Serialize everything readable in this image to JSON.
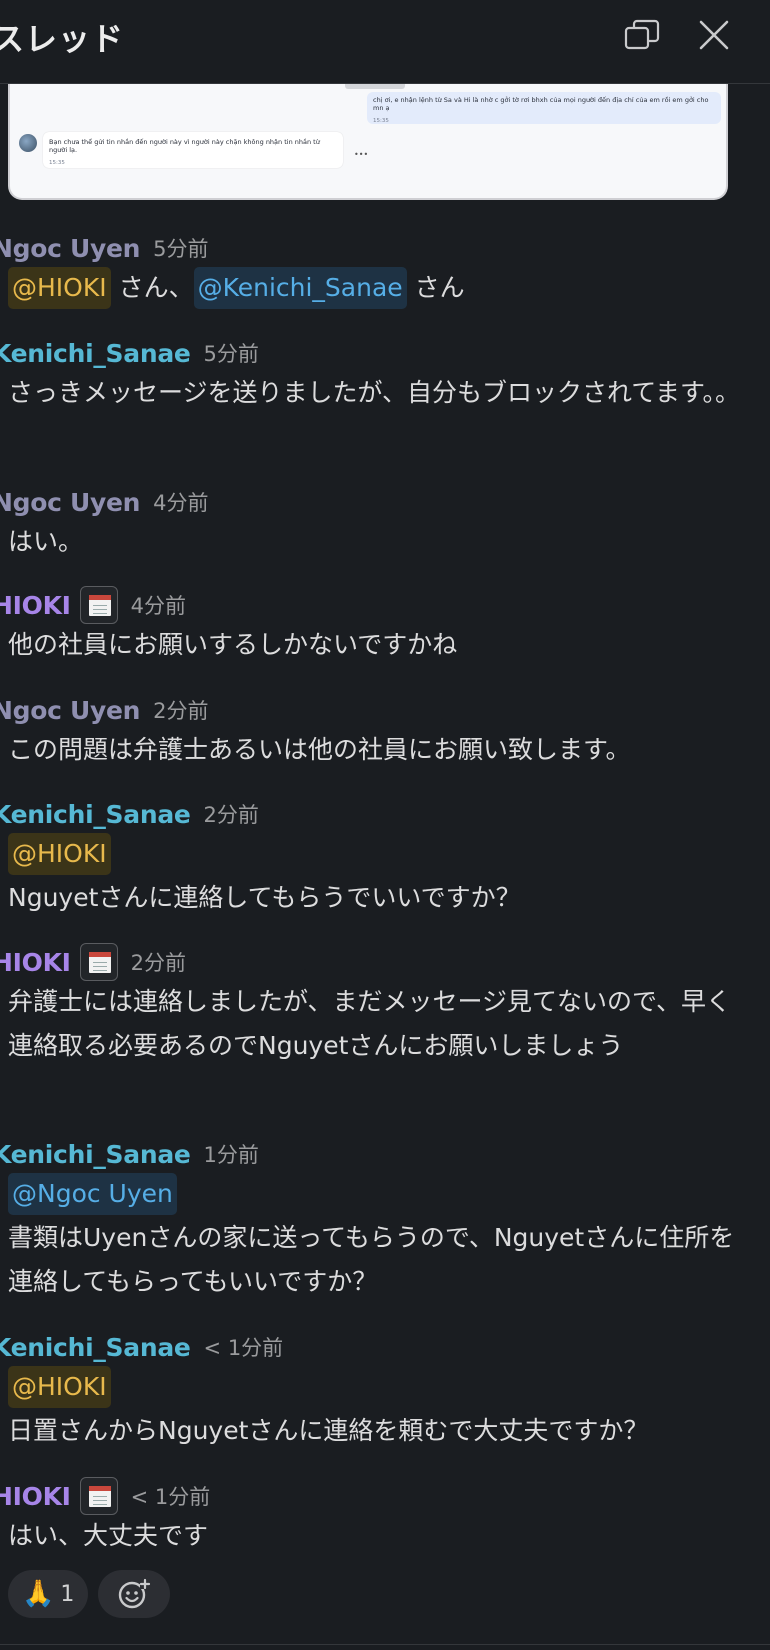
{
  "header": {
    "title": "スレッド",
    "popout_icon": "popout-window-icon",
    "close_icon": "close-icon"
  },
  "screenshot_preview": {
    "right_message": "chị ơi, e nhận lệnh từ Sa và Hi là nhờ c gởi tờ rơi bhxh của mọi người đến địa chỉ của em rồi em gởi cho mn ạ",
    "right_time": "15:35",
    "left_message": "Bạn chưa thể gửi tin nhắn đến người này vì người này chặn không nhận tin nhắn từ người lạ.",
    "left_time": "15:35"
  },
  "messages": [
    {
      "author": "Ngoc Uyen",
      "time": "5分前",
      "mention1": "@HIOKI",
      "mid": " さん、",
      "mention2": "@Kenichi_Sanae",
      "tail": " さん"
    },
    {
      "author": "Kenichi_Sanae",
      "time": "5分前",
      "text": "さっきメッセージを送りましたが、自分もブロックされてます。。"
    },
    {
      "author": "Ngoc Uyen",
      "time": "4分前",
      "text": "はい。"
    },
    {
      "author": "HIOKI",
      "time": "4分前",
      "text": "他の社員にお願いするしかないですかね"
    },
    {
      "author": "Ngoc Uyen",
      "time": "2分前",
      "text": "この問題は弁護士あるいは他の社員にお願い致します。"
    },
    {
      "author": "Kenichi_Sanae",
      "time": "2分前",
      "mention": "@HIOKI",
      "text": "Nguyetさんに連絡してもらうでいいですか？"
    },
    {
      "author": "HIOKI",
      "time": "2分前",
      "text": "弁護士には連絡しましたが、まだメッセージ見てないので、早く連絡取る必要あるのでNguyetさんにお願いしましょう"
    },
    {
      "author": "Kenichi_Sanae",
      "time": "1分前",
      "mention": "@Ngoc Uyen",
      "text": "書類はUyenさんの家に送ってもらうので、Nguyetさんに住所を連絡してもらってもいいですか？"
    },
    {
      "author": "Kenichi_Sanae",
      "time": "< 1分前",
      "mention": "@HIOKI",
      "text": "日置さんからNguyetさんに連絡を頼むで大丈夫ですか？"
    },
    {
      "author": "HIOKI",
      "time": "< 1分前",
      "text": "はい、大丈夫です"
    }
  ],
  "reactions": [
    {
      "emoji": "🙏",
      "count": "1"
    }
  ],
  "add_reaction_icon": "add-reaction-icon",
  "status_badge_icon": "calendar-icon",
  "colors": {
    "background": "#1a1d21",
    "mention_gold": "#e8b94c",
    "mention_blue": "#56aee6",
    "ngoc": "#8f8fb0",
    "kenichi": "#56b8d4",
    "hioki": "#a785e8"
  }
}
